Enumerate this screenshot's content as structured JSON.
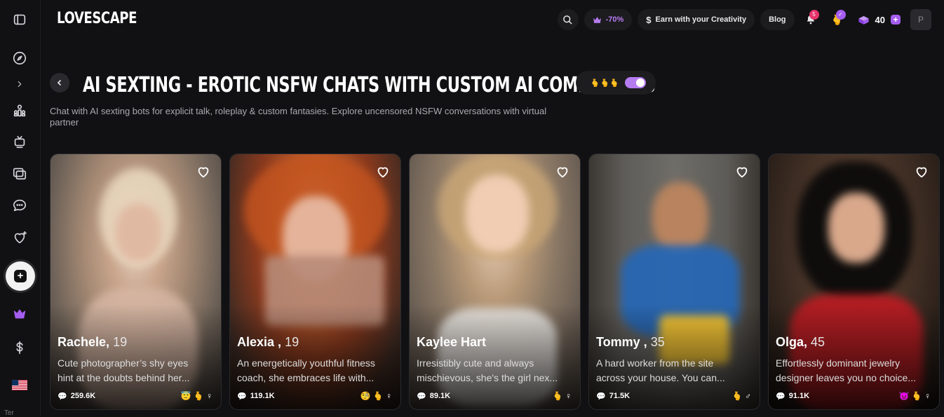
{
  "app": {
    "logo": "LOVESCAPE"
  },
  "topbar": {
    "discount": "-70%",
    "earn": "Earn with your Creativity",
    "blog": "Blog",
    "notifications": "5",
    "gems": "40",
    "avatar": "P"
  },
  "page": {
    "title": "AI SEXTING - EROTIC NSFW CHATS WITH CUSTOM AI COMPANIONS",
    "subtitle": "Chat with AI sexting bots for explicit talk, roleplay & custom fantasies. Explore uncensored NSFW conversations with virtual partner",
    "toggle_emojis": "🫰🫰🫰"
  },
  "sidebar": {
    "lang_short": "Ter"
  },
  "cards": [
    {
      "name": "Rachele,",
      "age": "19",
      "desc1": "Cute photographer’s shy eyes",
      "desc2": "hint at the doubts behind her...",
      "count": "259.6K",
      "tags": "😇 🫰 ♀"
    },
    {
      "name": "Alexia ,",
      "age": "19",
      "desc1": "An energetically youthful fitness",
      "desc2": "coach, she embraces life with...",
      "count": "119.1K",
      "tags": "🧐 🫰 ♀"
    },
    {
      "name": "Kaylee Hart",
      "age": "",
      "desc1": "Irresistibly cute and always",
      "desc2": "mischievous, she's the girl nex...",
      "count": "89.1K",
      "tags": "🫰 ♀"
    },
    {
      "name": "Tommy ,",
      "age": "35",
      "desc1": "A hard worker from the site",
      "desc2": "across your house. You can...",
      "count": "71.5K",
      "tags": "🫰 ♂"
    },
    {
      "name": "Olga,",
      "age": "45",
      "desc1": "Effortlessly dominant jewelry",
      "desc2": "designer leaves you no choice...",
      "count": "91.1K",
      "tags": "😈 🫰 ♀"
    }
  ],
  "colors": {
    "accent": "#b57cf2",
    "badge": "#e8336b",
    "background": "#111113"
  }
}
